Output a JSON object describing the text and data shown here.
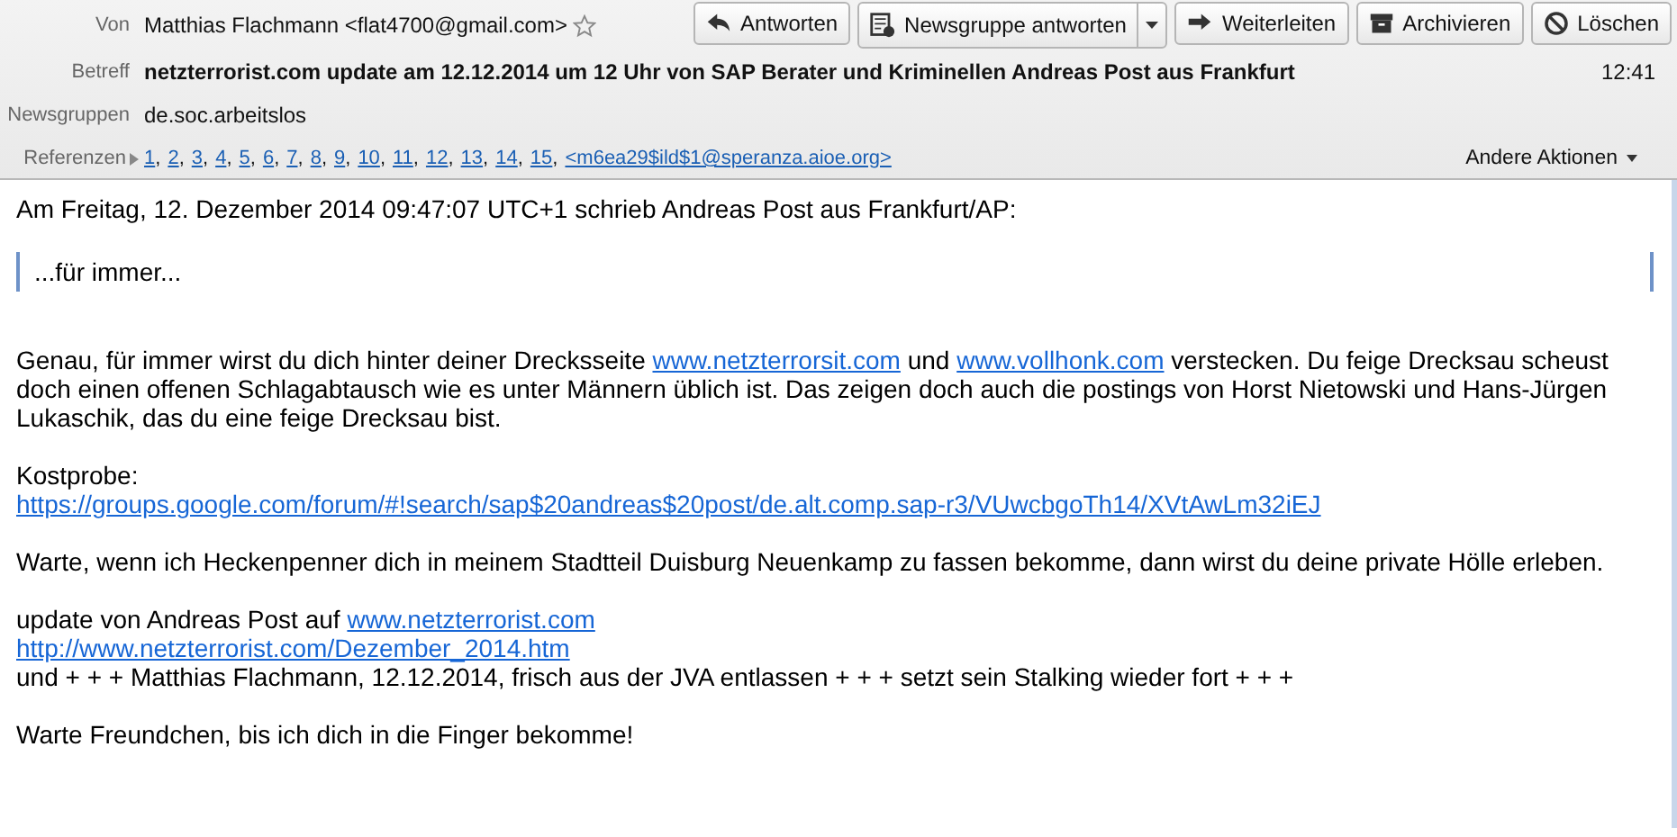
{
  "header": {
    "from": {
      "label": "Von",
      "value": "Matthias Flachmann <flat4700@gmail.com>",
      "starred": false
    },
    "buttons": [
      {
        "label": "Antworten",
        "menu": false
      },
      {
        "label": "Newsgruppe antworten",
        "menu": true
      },
      {
        "label": "Weiterleiten",
        "menu": false
      },
      {
        "label": "Archivieren",
        "menu": false
      },
      {
        "label": "Löschen",
        "menu": false
      }
    ],
    "subject": {
      "label": "Betreff",
      "value": "netzterrorist.com update am 12.12.2014 um 12 Uhr von SAP Berater und Kriminellen Andreas Post aus Frankfurt",
      "time": "12:41"
    },
    "newsgroups": {
      "label": "Newsgruppen",
      "value": "de.soc.arbeitslos"
    },
    "references": {
      "label": "Referenzen",
      "expanded": false,
      "separator": ",",
      "items": [
        "1",
        "2",
        "3",
        "4",
        "5",
        "6",
        "7",
        "8",
        "9",
        "10",
        "11",
        "12",
        "13",
        "14",
        "15",
        "<m6ea29$ild$1@speranza.aioe.org>"
      ]
    },
    "more_actions": "Andere Aktionen"
  },
  "body": [
    {
      "kind": "text",
      "lines": [
        [
          {
            "text": "Am Freitag, 12. Dezember 2014 09:47:07 UTC+1 schrieb Andreas Post aus Frankfurt/AP:",
            "link": false
          }
        ]
      ]
    },
    {
      "kind": "quote",
      "lines": [
        [
          {
            "text": "...für immer...",
            "link": false
          }
        ]
      ]
    },
    {
      "kind": "text",
      "lines": [
        [
          {
            "text": "Genau, für immer wirst du dich hinter deiner Drecksseite ",
            "link": false
          },
          {
            "text": "www.netzterrorsit.com",
            "link": true
          },
          {
            "text": " und ",
            "link": false
          },
          {
            "text": "www.vollhonk.com",
            "link": true
          },
          {
            "text": " verstecken. Du feige Drecksau scheust doch einen offenen Schlagabtausch wie es unter Männern üblich ist. Das zeigen doch auch die postings von Horst Nietowski und Hans-Jürgen Lukaschik, das du eine feige Drecksau bist.",
            "link": false
          }
        ]
      ]
    },
    {
      "kind": "text",
      "lines": [
        [
          {
            "text": "Kostprobe:",
            "link": false
          }
        ],
        [
          {
            "text": "https://groups.google.com/forum/#!search/sap$20andreas$20post/de.alt.comp.sap-r3/VUwcbgoTh14/XVtAwLm32iEJ",
            "link": true
          }
        ]
      ]
    },
    {
      "kind": "text",
      "lines": [
        [
          {
            "text": "Warte, wenn ich Heckenpenner dich in meinem Stadtteil Duisburg Neuenkamp zu fassen bekomme, dann wirst du deine private Hölle erleben.",
            "link": false
          }
        ]
      ]
    },
    {
      "kind": "text",
      "lines": [
        [
          {
            "text": "update von Andreas Post auf ",
            "link": false
          },
          {
            "text": "www.netzterrorist.com",
            "link": true
          }
        ],
        [
          {
            "text": "http://www.netzterrorist.com/Dezember_2014.htm",
            "link": true
          }
        ],
        [
          {
            "text": "und + + + Matthias Flachmann, 12.12.2014, frisch aus der JVA entlassen + + + setzt sein Stalking wieder fort + + +",
            "link": false
          }
        ]
      ]
    },
    {
      "kind": "text",
      "lines": [
        [
          {
            "text": "Warte Freundchen, bis ich dich in die Finger bekomme!",
            "link": false
          }
        ]
      ]
    }
  ]
}
